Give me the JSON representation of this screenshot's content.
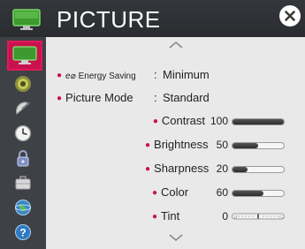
{
  "header": {
    "title": "PICTURE",
    "close_icon": "close-icon",
    "title_icon": "tv-icon"
  },
  "sidebar": {
    "items": [
      {
        "name": "picture",
        "icon": "tv-icon",
        "active": true
      },
      {
        "name": "sound",
        "icon": "speaker-icon",
        "active": false
      },
      {
        "name": "channels",
        "icon": "satellite-dish-icon",
        "active": false
      },
      {
        "name": "time",
        "icon": "clock-icon",
        "active": false
      },
      {
        "name": "lock",
        "icon": "lock-icon",
        "active": false
      },
      {
        "name": "option",
        "icon": "briefcase-icon",
        "active": false
      },
      {
        "name": "network",
        "icon": "globe-icon",
        "active": false
      },
      {
        "name": "support",
        "icon": "help-icon",
        "active": false
      }
    ]
  },
  "settings": {
    "energy_saving_prefix": "e⌀",
    "energy_saving_label": "Energy Saving",
    "energy_saving_value": "Minimum",
    "picture_mode_label": "Picture Mode",
    "picture_mode_value": "Standard",
    "colon": ":"
  },
  "adjustments": [
    {
      "label": "Contrast",
      "value": "100",
      "level": 1.0
    },
    {
      "label": "Brightness",
      "value": "50",
      "level": 0.5
    },
    {
      "label": "Sharpness",
      "value": "20",
      "level": 0.3
    },
    {
      "label": "Color",
      "value": "60",
      "level": 0.6
    },
    {
      "label": "Tint",
      "value": "0",
      "level": 0.5
    }
  ],
  "colors": {
    "accent": "#c8124d",
    "header_bg": "#2a2c30",
    "content_bg": "#e9e9ea"
  }
}
